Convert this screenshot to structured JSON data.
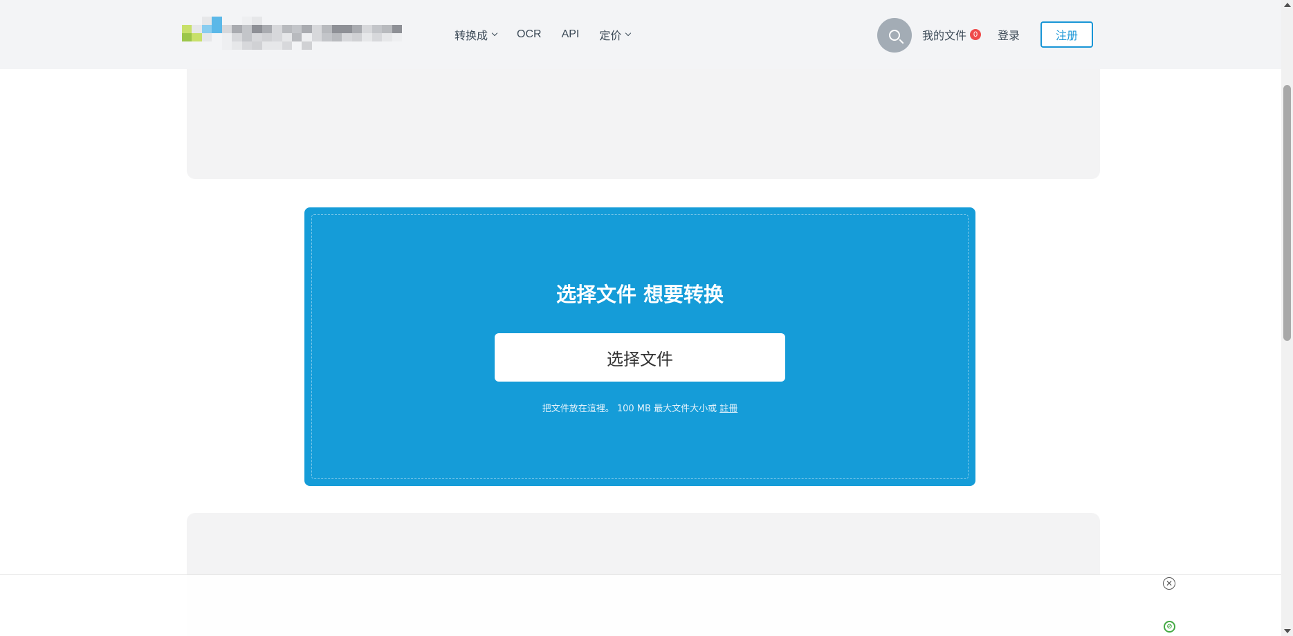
{
  "header": {
    "nav": [
      {
        "label": "转换成",
        "has_dropdown": true
      },
      {
        "label": "OCR",
        "has_dropdown": false
      },
      {
        "label": "API",
        "has_dropdown": false
      },
      {
        "label": "定价",
        "has_dropdown": true
      }
    ],
    "search_icon": "search-icon",
    "my_files_label": "我的文件",
    "my_files_count": "0",
    "login_label": "登录",
    "register_label": "注册"
  },
  "upload": {
    "title": "选择文件 想要转换",
    "button_label": "选择文件",
    "note_prefix": "把文件放在這裡。 100 MB 最大文件大小或",
    "note_link": "註冊"
  },
  "ad": {
    "close_icon": "close-circle-icon",
    "info_icon": "ad-info-icon"
  },
  "colors": {
    "accent": "#159cd8",
    "register_border": "#1795d6",
    "badge": "#ef4b4b",
    "header_bg": "#f3f4f6"
  }
}
